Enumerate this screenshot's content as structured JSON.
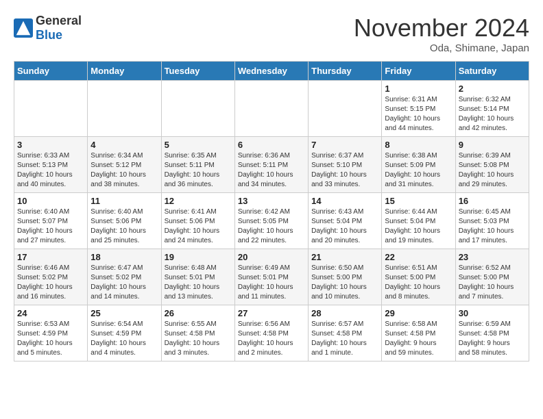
{
  "header": {
    "logo_general": "General",
    "logo_blue": "Blue",
    "month_title": "November 2024",
    "location": "Oda, Shimane, Japan"
  },
  "days_of_week": [
    "Sunday",
    "Monday",
    "Tuesday",
    "Wednesday",
    "Thursday",
    "Friday",
    "Saturday"
  ],
  "weeks": [
    [
      {
        "day": "",
        "info": ""
      },
      {
        "day": "",
        "info": ""
      },
      {
        "day": "",
        "info": ""
      },
      {
        "day": "",
        "info": ""
      },
      {
        "day": "",
        "info": ""
      },
      {
        "day": "1",
        "info": "Sunrise: 6:31 AM\nSunset: 5:15 PM\nDaylight: 10 hours\nand 44 minutes."
      },
      {
        "day": "2",
        "info": "Sunrise: 6:32 AM\nSunset: 5:14 PM\nDaylight: 10 hours\nand 42 minutes."
      }
    ],
    [
      {
        "day": "3",
        "info": "Sunrise: 6:33 AM\nSunset: 5:13 PM\nDaylight: 10 hours\nand 40 minutes."
      },
      {
        "day": "4",
        "info": "Sunrise: 6:34 AM\nSunset: 5:12 PM\nDaylight: 10 hours\nand 38 minutes."
      },
      {
        "day": "5",
        "info": "Sunrise: 6:35 AM\nSunset: 5:11 PM\nDaylight: 10 hours\nand 36 minutes."
      },
      {
        "day": "6",
        "info": "Sunrise: 6:36 AM\nSunset: 5:11 PM\nDaylight: 10 hours\nand 34 minutes."
      },
      {
        "day": "7",
        "info": "Sunrise: 6:37 AM\nSunset: 5:10 PM\nDaylight: 10 hours\nand 33 minutes."
      },
      {
        "day": "8",
        "info": "Sunrise: 6:38 AM\nSunset: 5:09 PM\nDaylight: 10 hours\nand 31 minutes."
      },
      {
        "day": "9",
        "info": "Sunrise: 6:39 AM\nSunset: 5:08 PM\nDaylight: 10 hours\nand 29 minutes."
      }
    ],
    [
      {
        "day": "10",
        "info": "Sunrise: 6:40 AM\nSunset: 5:07 PM\nDaylight: 10 hours\nand 27 minutes."
      },
      {
        "day": "11",
        "info": "Sunrise: 6:40 AM\nSunset: 5:06 PM\nDaylight: 10 hours\nand 25 minutes."
      },
      {
        "day": "12",
        "info": "Sunrise: 6:41 AM\nSunset: 5:06 PM\nDaylight: 10 hours\nand 24 minutes."
      },
      {
        "day": "13",
        "info": "Sunrise: 6:42 AM\nSunset: 5:05 PM\nDaylight: 10 hours\nand 22 minutes."
      },
      {
        "day": "14",
        "info": "Sunrise: 6:43 AM\nSunset: 5:04 PM\nDaylight: 10 hours\nand 20 minutes."
      },
      {
        "day": "15",
        "info": "Sunrise: 6:44 AM\nSunset: 5:04 PM\nDaylight: 10 hours\nand 19 minutes."
      },
      {
        "day": "16",
        "info": "Sunrise: 6:45 AM\nSunset: 5:03 PM\nDaylight: 10 hours\nand 17 minutes."
      }
    ],
    [
      {
        "day": "17",
        "info": "Sunrise: 6:46 AM\nSunset: 5:02 PM\nDaylight: 10 hours\nand 16 minutes."
      },
      {
        "day": "18",
        "info": "Sunrise: 6:47 AM\nSunset: 5:02 PM\nDaylight: 10 hours\nand 14 minutes."
      },
      {
        "day": "19",
        "info": "Sunrise: 6:48 AM\nSunset: 5:01 PM\nDaylight: 10 hours\nand 13 minutes."
      },
      {
        "day": "20",
        "info": "Sunrise: 6:49 AM\nSunset: 5:01 PM\nDaylight: 10 hours\nand 11 minutes."
      },
      {
        "day": "21",
        "info": "Sunrise: 6:50 AM\nSunset: 5:00 PM\nDaylight: 10 hours\nand 10 minutes."
      },
      {
        "day": "22",
        "info": "Sunrise: 6:51 AM\nSunset: 5:00 PM\nDaylight: 10 hours\nand 8 minutes."
      },
      {
        "day": "23",
        "info": "Sunrise: 6:52 AM\nSunset: 5:00 PM\nDaylight: 10 hours\nand 7 minutes."
      }
    ],
    [
      {
        "day": "24",
        "info": "Sunrise: 6:53 AM\nSunset: 4:59 PM\nDaylight: 10 hours\nand 5 minutes."
      },
      {
        "day": "25",
        "info": "Sunrise: 6:54 AM\nSunset: 4:59 PM\nDaylight: 10 hours\nand 4 minutes."
      },
      {
        "day": "26",
        "info": "Sunrise: 6:55 AM\nSunset: 4:58 PM\nDaylight: 10 hours\nand 3 minutes."
      },
      {
        "day": "27",
        "info": "Sunrise: 6:56 AM\nSunset: 4:58 PM\nDaylight: 10 hours\nand 2 minutes."
      },
      {
        "day": "28",
        "info": "Sunrise: 6:57 AM\nSunset: 4:58 PM\nDaylight: 10 hours\nand 1 minute."
      },
      {
        "day": "29",
        "info": "Sunrise: 6:58 AM\nSunset: 4:58 PM\nDaylight: 9 hours\nand 59 minutes."
      },
      {
        "day": "30",
        "info": "Sunrise: 6:59 AM\nSunset: 4:58 PM\nDaylight: 9 hours\nand 58 minutes."
      }
    ]
  ]
}
